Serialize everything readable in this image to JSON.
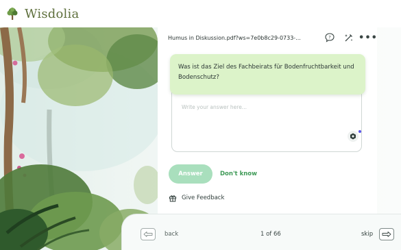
{
  "app": {
    "name": "Wisdolia",
    "logo_icon": "tree-icon"
  },
  "card": {
    "filename": "Humus in Diskussion.pdf?ws=7e0b8c29-0733-...",
    "question": "Was ist das Ziel des Fachbeirats für Bodenfruchtbarkeit und Bodenschutz?",
    "answer_value": "",
    "answer_placeholder": "Write your answer here...",
    "header_icons": [
      "chat-question-icon",
      "edit-sparkle-icon",
      "more-options-icon"
    ],
    "more_label": "•••"
  },
  "actions": {
    "answer_label": "Answer",
    "dont_know_label": "Don't know",
    "feedback_label": "Give Feedback"
  },
  "nav": {
    "back_label": "back",
    "progress": "1 of 66",
    "skip_label": "skip"
  },
  "colors": {
    "question_bg": "#dcf3c9",
    "answer_button": "#a9dfbd",
    "dont_know_text": "#3f9a57",
    "logo_text": "#5e6f3c",
    "assist_dot": "#5a55e8"
  }
}
